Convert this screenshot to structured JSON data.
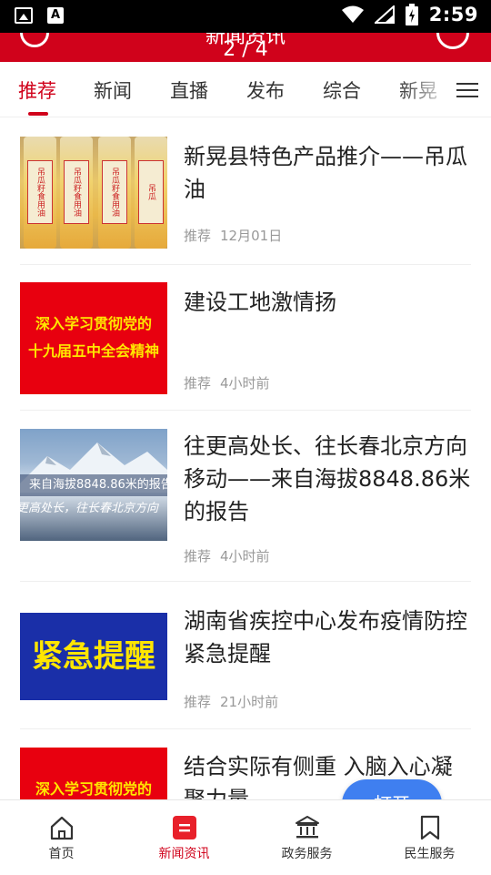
{
  "status_bar": {
    "time": "2:59"
  },
  "header": {
    "title": "新闻资讯",
    "pager": "2 / 4"
  },
  "tabs": [
    {
      "label": "推荐",
      "active": true
    },
    {
      "label": "新闻",
      "active": false
    },
    {
      "label": "直播",
      "active": false
    },
    {
      "label": "发布",
      "active": false
    },
    {
      "label": "综合",
      "active": false
    },
    {
      "label": "新晃",
      "active": false
    }
  ],
  "articles": [
    {
      "title": "新晃县特色产品推介——吊瓜油",
      "category": "推荐",
      "time": "12月01日",
      "thumb_text": [
        "吊瓜籽食用油",
        "吊瓜籽食用油",
        "吊瓜籽食用油"
      ]
    },
    {
      "title": "建设工地激情扬",
      "category": "推荐",
      "time": "4小时前",
      "thumb_text": [
        "深入学习贯彻党的",
        "十九届五中全会精神"
      ]
    },
    {
      "title": "往更高处长、往长春北京方向移动——来自海拔8848.86米的报告",
      "category": "推荐",
      "time": "4小时前",
      "thumb_text": [
        "来自海拔8848.86米的报告",
        "更高处长，往长春北京方向"
      ]
    },
    {
      "title": "湖南省疾控中心发布疫情防控紧急提醒",
      "category": "推荐",
      "time": "21小时前",
      "thumb_text": [
        "紧急提醒"
      ]
    },
    {
      "title": "结合实际有侧重 入脑入心凝聚力量",
      "category": "推荐",
      "time": "",
      "thumb_text": [
        "深入学习贯彻党的"
      ]
    }
  ],
  "floating_button": {
    "label": "打开"
  },
  "bottom_nav": [
    {
      "label": "首页",
      "icon": "home-icon",
      "active": false
    },
    {
      "label": "新闻资讯",
      "icon": "news-icon",
      "active": true
    },
    {
      "label": "政务服务",
      "icon": "government-icon",
      "active": false
    },
    {
      "label": "民生服务",
      "icon": "bookmark-icon",
      "active": false
    }
  ],
  "colors": {
    "accent": "#d0021b",
    "button": "#3f7ff0"
  }
}
